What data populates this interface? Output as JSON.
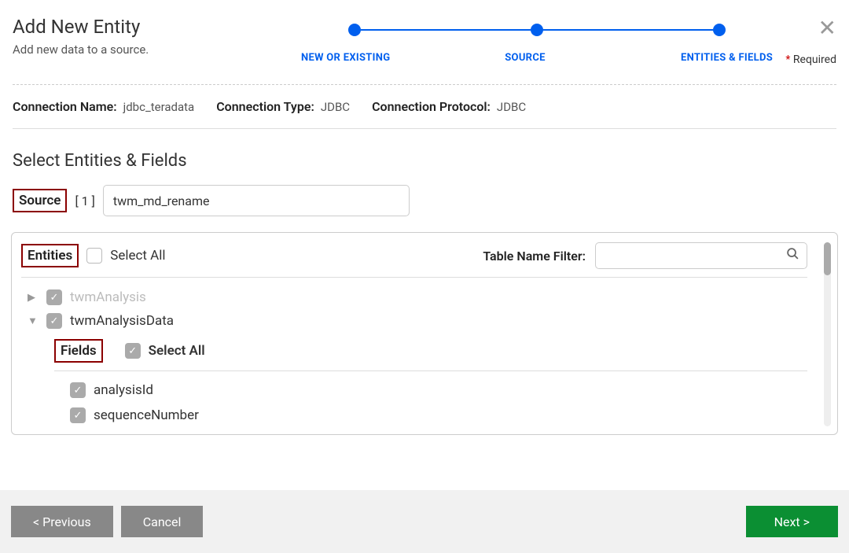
{
  "header": {
    "title": "Add New Entity",
    "subtitle": "Add new data to a source.",
    "required_label": "Required"
  },
  "stepper": {
    "steps": [
      "NEW OR EXISTING",
      "SOURCE",
      "ENTITIES & FIELDS"
    ]
  },
  "connection": {
    "name_label": "Connection Name:",
    "name_value": "jdbc_teradata",
    "type_label": "Connection Type:",
    "type_value": "JDBC",
    "protocol_label": "Connection Protocol:",
    "protocol_value": "JDBC"
  },
  "section": {
    "title": "Select Entities & Fields"
  },
  "source": {
    "label": "Source",
    "count": "[ 1 ]",
    "value": "twm_md_rename"
  },
  "entities": {
    "label": "Entities",
    "select_all": "Select All",
    "filter_label": "Table Name Filter:",
    "items": [
      {
        "name": "twmAnalysis",
        "expanded": false,
        "checked": true,
        "dimmed": true
      },
      {
        "name": "twmAnalysisData",
        "expanded": true,
        "checked": true,
        "dimmed": false
      }
    ]
  },
  "fields": {
    "label": "Fields",
    "select_all": "Select All",
    "items": [
      {
        "name": "analysisId",
        "checked": true
      },
      {
        "name": "sequenceNumber",
        "checked": true
      }
    ]
  },
  "footer": {
    "previous": "< Previous",
    "cancel": "Cancel",
    "next": "Next >"
  }
}
